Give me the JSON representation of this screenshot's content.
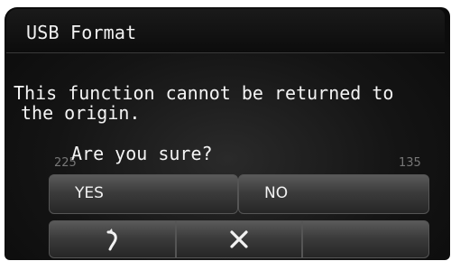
{
  "dialog": {
    "title": "USB Format",
    "message_line1": "This function cannot be returned to",
    "message_line2": "the origin.",
    "question": "Are you sure?"
  },
  "background": {
    "dial_left": "225",
    "dial_right": "135"
  },
  "buttons": {
    "yes_label": "YES",
    "no_label": "NO"
  },
  "bottom_bar": {
    "items": [
      {
        "icon": "back-arrow-icon"
      },
      {
        "icon": "close-icon"
      },
      {
        "icon": ""
      }
    ]
  },
  "colors": {
    "text": "#f4f4f4",
    "background": "#141414",
    "button": "#3c3c3c"
  }
}
